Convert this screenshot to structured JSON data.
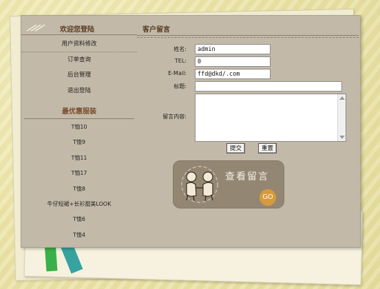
{
  "sidebar": {
    "welcome_title": "欢迎您登陆",
    "menu": [
      {
        "label": "用户资料修改"
      },
      {
        "label": "订单查询"
      },
      {
        "label": "后台管理"
      },
      {
        "label": "退出登陆"
      }
    ],
    "deals_title": "最优惠服装",
    "products": [
      {
        "label": "T恤10"
      },
      {
        "label": "T恤9"
      },
      {
        "label": "T恤11"
      },
      {
        "label": "T恤17"
      },
      {
        "label": "T恤8"
      },
      {
        "label": "牛仔短裙+长衫甜美LOOK"
      },
      {
        "label": "T恤6"
      },
      {
        "label": "T恤4"
      }
    ]
  },
  "form": {
    "title": "客户留言",
    "name_label": "姓名:",
    "name_value": "admin",
    "tel_label": "TEL:",
    "tel_value": "0",
    "email_label": "E-Mail:",
    "email_value": "ffd@dkd/.com",
    "subject_label": "标题:",
    "subject_value": "",
    "content_label": "留言内容:",
    "content_value": "",
    "submit_label": "提交",
    "reset_label": "重置"
  },
  "view_card": {
    "title": "查看留言",
    "go_label": "GO"
  },
  "colors": {
    "panel": "#c2b9a8",
    "card": "#938774",
    "go": "#d89a3a",
    "heading": "#5a3d28"
  },
  "icons": [
    "slash-icon",
    "figures-illustration",
    "scroll-up-icon",
    "scroll-down-icon"
  ]
}
